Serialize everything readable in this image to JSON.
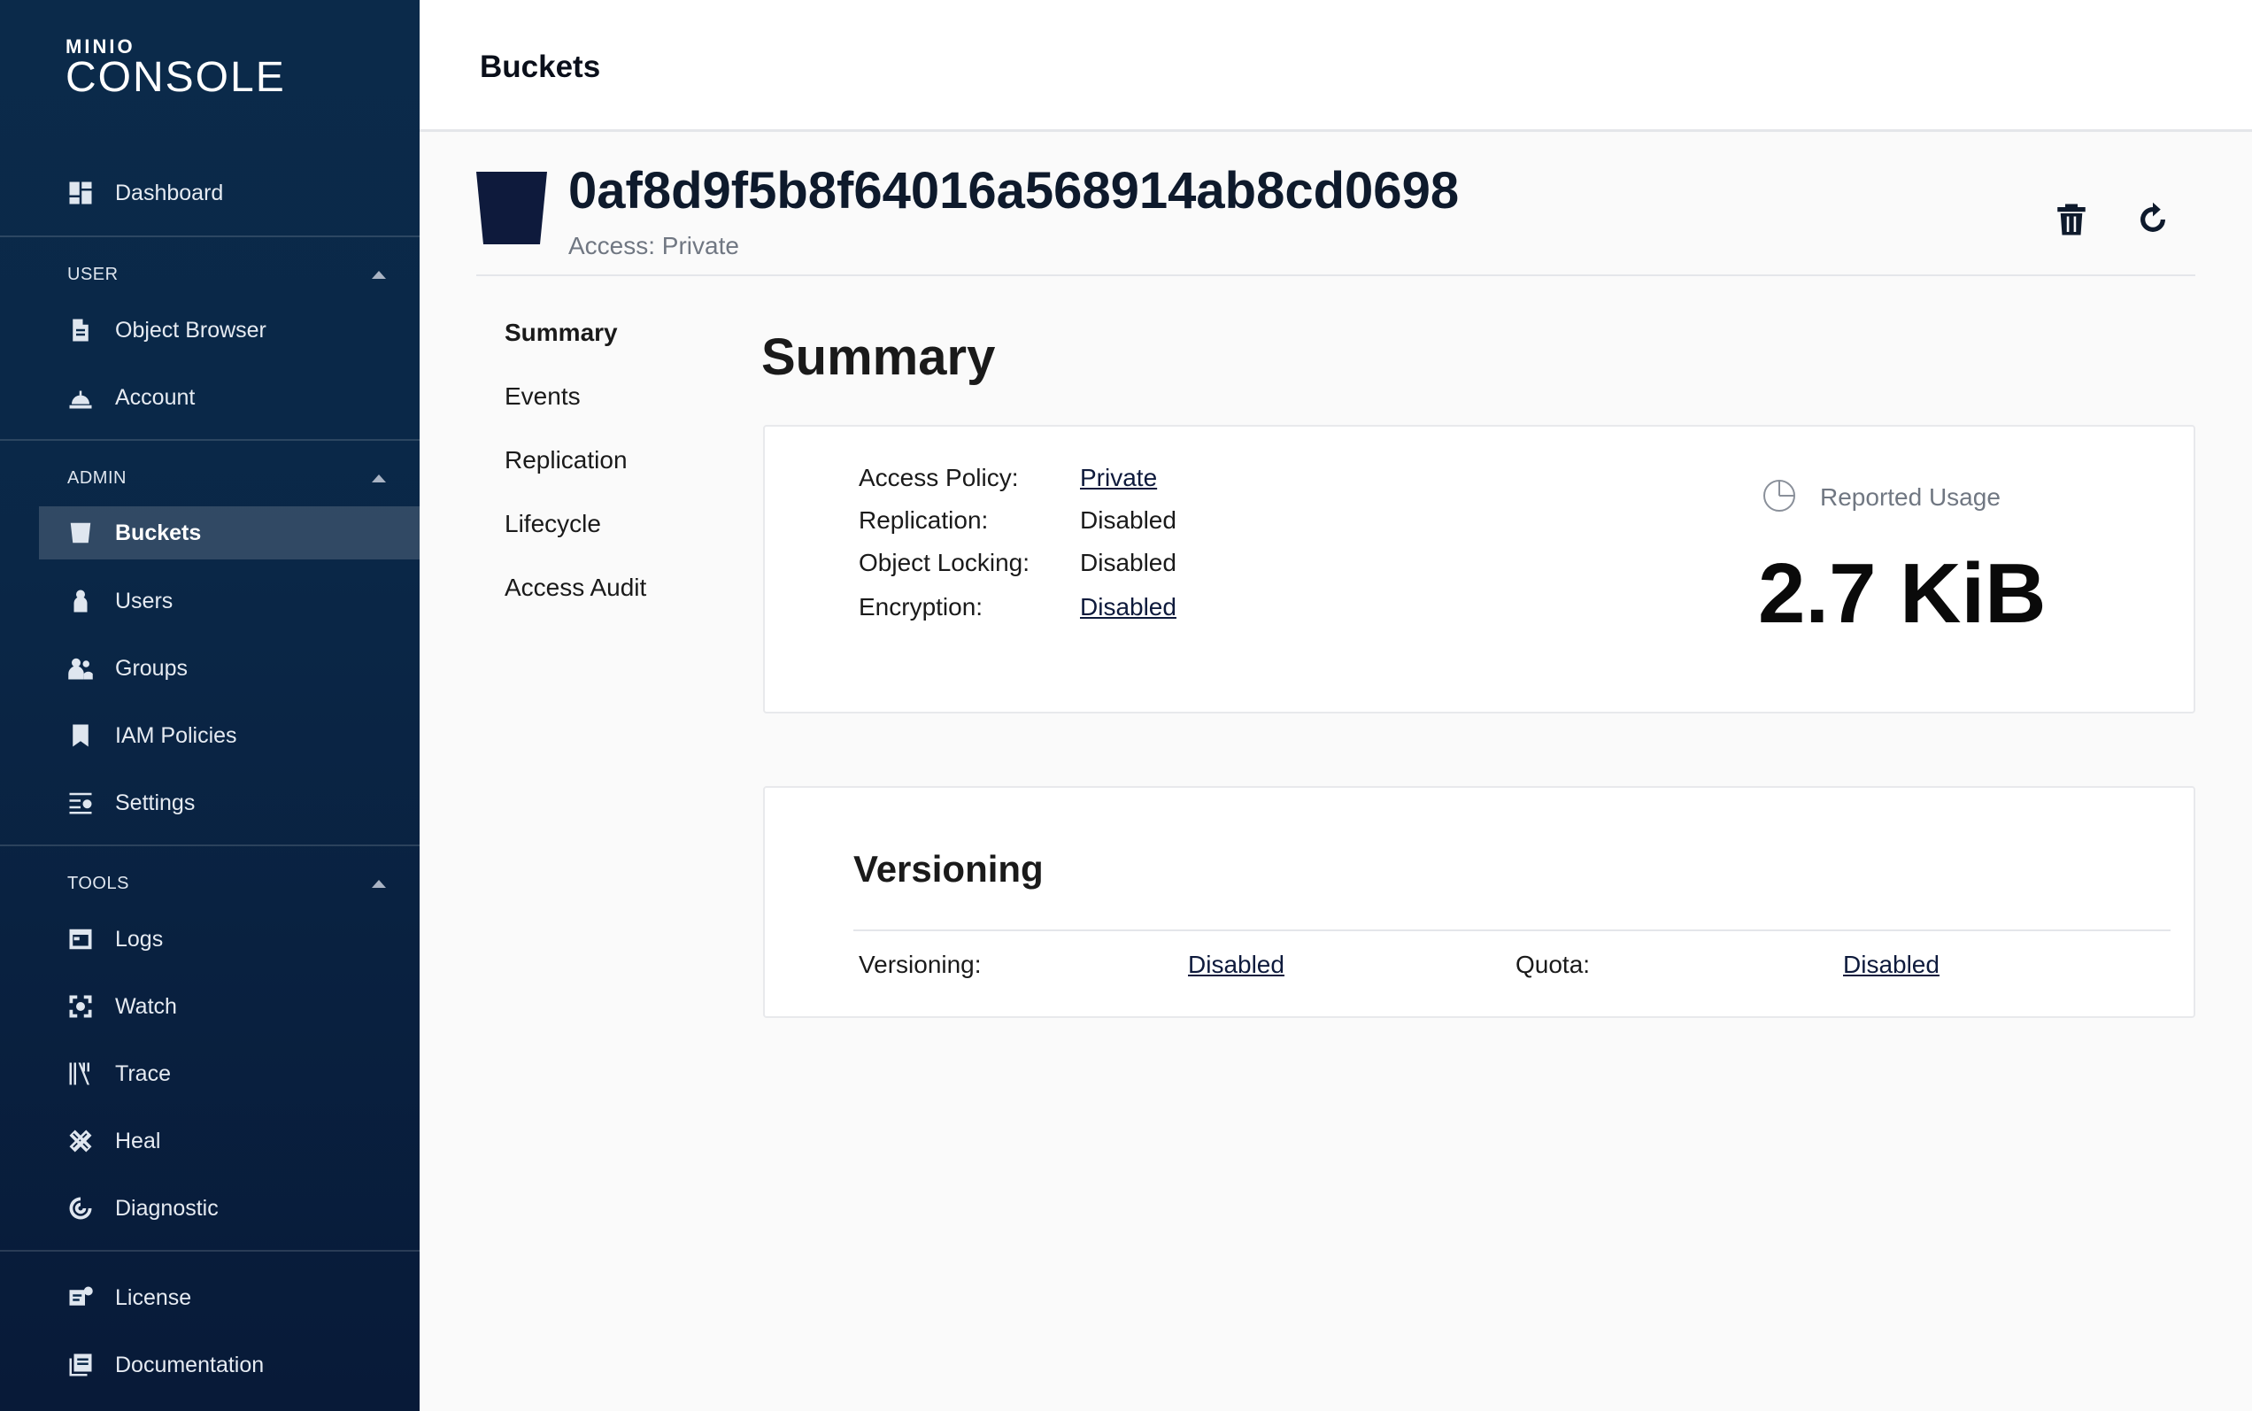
{
  "logo": {
    "top": "MINIO",
    "bottom": "CONSOLE"
  },
  "sidebar": {
    "dashboard": "Dashboard",
    "sections": {
      "user": "USER",
      "admin": "ADMIN",
      "tools": "TOOLS"
    },
    "user_items": [
      "Object Browser",
      "Account"
    ],
    "admin_items": [
      "Buckets",
      "Users",
      "Groups",
      "IAM Policies",
      "Settings"
    ],
    "tools_items": [
      "Logs",
      "Watch",
      "Trace",
      "Heal",
      "Diagnostic"
    ],
    "bottom_items": [
      "License",
      "Documentation"
    ],
    "active_item": "Buckets"
  },
  "topbar": {
    "title": "Buckets"
  },
  "bucket": {
    "name": "0af8d9f5b8f64016a568914ab8cd0698",
    "access": "Access: Private"
  },
  "subnav": [
    "Summary",
    "Events",
    "Replication",
    "Lifecycle",
    "Access Audit"
  ],
  "summary": {
    "title": "Summary",
    "rows": [
      {
        "label": "Access Policy:",
        "value": "Private",
        "link": true
      },
      {
        "label": "Replication:",
        "value": "Disabled",
        "link": false
      },
      {
        "label": "Object Locking:",
        "value": "Disabled",
        "link": false
      },
      {
        "label": "Encryption:",
        "value": "Disabled",
        "link": true
      }
    ],
    "usage_label": "Reported Usage",
    "usage_value": "2.7 KiB"
  },
  "versioning": {
    "title": "Versioning",
    "versioning_label": "Versioning:",
    "versioning_value": "Disabled",
    "quota_label": "Quota:",
    "quota_value": "Disabled"
  },
  "colors": {
    "sidebar_bg": "#0b2a4a",
    "accent_dark": "#0e1a2c"
  },
  "icons": {
    "dashboard": "dashboard-icon",
    "object_browser": "document-icon",
    "account": "bell-icon",
    "buckets": "bucket-icon",
    "users": "user-icon",
    "groups": "group-icon",
    "iam_policies": "bookmark-icon",
    "settings": "settings-icon",
    "logs": "window-icon",
    "watch": "watch-icon",
    "trace": "trace-icon",
    "heal": "heal-icon",
    "diagnostic": "diagnostic-icon",
    "license": "license-icon",
    "documentation": "documentation-icon",
    "delete": "trash-icon",
    "refresh": "refresh-icon",
    "usage": "pie-chart-icon"
  }
}
